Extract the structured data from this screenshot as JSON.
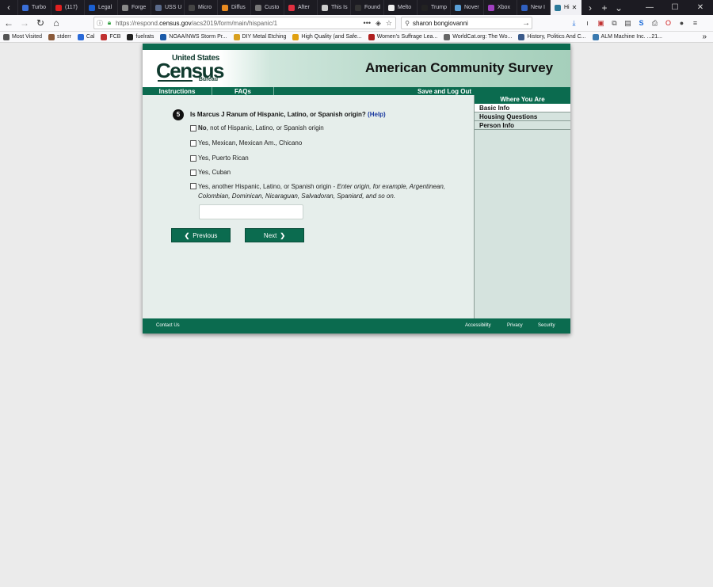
{
  "browser": {
    "tabs": [
      {
        "label": "Turbo",
        "color": "#3a6fd8"
      },
      {
        "label": "(117)",
        "color": "#e02020"
      },
      {
        "label": "Legal",
        "color": "#1a5fd0"
      },
      {
        "label": "Forge",
        "color": "#888888"
      },
      {
        "label": "USS U",
        "color": "#5a6a8a"
      },
      {
        "label": "Micro",
        "color": "#444444"
      },
      {
        "label": "Diffus",
        "color": "#e88a20"
      },
      {
        "label": "Custo",
        "color": "#777777"
      },
      {
        "label": "After",
        "color": "#e03040"
      },
      {
        "label": "This Is",
        "color": "#cccccc"
      },
      {
        "label": "Found",
        "color": "#333333"
      },
      {
        "label": "Melto",
        "color": "#eeeeee"
      },
      {
        "label": "Trump",
        "color": "#222222"
      },
      {
        "label": "Nover",
        "color": "#5aa0d8"
      },
      {
        "label": "Xbox",
        "color": "#a040c0"
      },
      {
        "label": "New I",
        "color": "#3060c0"
      },
      {
        "label": "Hi",
        "color": "#2a7a9a"
      }
    ],
    "url_prefix": "https://respond.",
    "url_domain": "census.gov",
    "url_path": "/acs2019/form/main/hispanic/1",
    "search_value": "sharon bongiovanni",
    "bookmarks": [
      {
        "label": "Most Visited",
        "color": "#555555"
      },
      {
        "label": "stderr",
        "color": "#8a5a3a"
      },
      {
        "label": "Cal",
        "color": "#2a6ad8"
      },
      {
        "label": "FCB",
        "color": "#c03030"
      },
      {
        "label": "fuelrats",
        "color": "#222222"
      },
      {
        "label": "NOAA/NWS Storm Pr...",
        "color": "#1a5aa8"
      },
      {
        "label": "DIY Metal Etching",
        "color": "#d8a020"
      },
      {
        "label": "High Quality (and Safe...",
        "color": "#e0a010"
      },
      {
        "label": "Women's Suffrage Lea...",
        "color": "#b02020"
      },
      {
        "label": "WorldCat.org: The Wo...",
        "color": "#666666"
      },
      {
        "label": "History, Politics And C...",
        "color": "#3a5a8a"
      },
      {
        "label": "ALM Machine Inc. ...21...",
        "color": "#3a7ab0"
      }
    ]
  },
  "header": {
    "logo_line1": "United States",
    "logo_line2": "Census",
    "logo_line3": "Bureau",
    "title": "American Community Survey"
  },
  "menu": {
    "instructions": "Instructions",
    "faqs": "FAQs",
    "save": "Save and Log Out"
  },
  "sidebar": {
    "heading": "Where You Are",
    "items": [
      "Basic Info",
      "Housing Questions",
      "Person Info"
    ]
  },
  "question": {
    "number": "5",
    "text": "Is Marcus J Ranum of Hispanic, Latino, or Spanish origin?",
    "help": "(Help)",
    "options": [
      {
        "bold": "No",
        "rest": ", not of Hispanic, Latino, or Spanish origin"
      },
      {
        "text": "Yes, Mexican, Mexican Am., Chicano"
      },
      {
        "text": "Yes, Puerto Rican"
      },
      {
        "text": "Yes, Cuban"
      },
      {
        "text": "Yes, another Hispanic, Latino, or Spanish origin - ",
        "italic": "Enter origin, for example, Argentinean, Colombian, Dominican, Nicaraguan, Salvadoran, Spaniard, and so on."
      }
    ],
    "origin_value": ""
  },
  "buttons": {
    "previous": "Previous",
    "next": "Next"
  },
  "footer": {
    "contact": "Contact Us",
    "accessibility": "Accessibility",
    "privacy": "Privacy",
    "security": "Security"
  }
}
